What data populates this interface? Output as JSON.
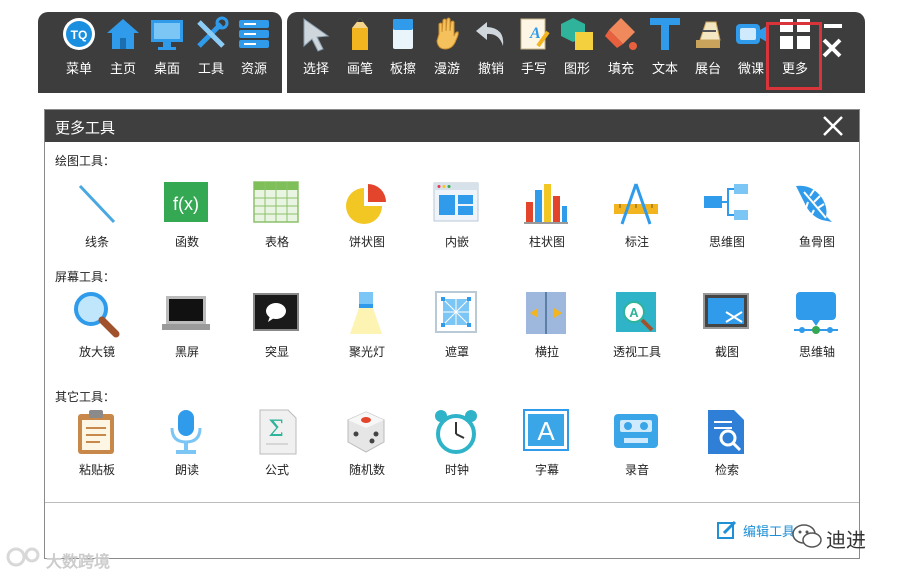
{
  "toolbar": {
    "left_items": [
      {
        "label": "菜单",
        "icon": "app-logo-icon"
      },
      {
        "label": "主页",
        "icon": "home-icon"
      },
      {
        "label": "桌面",
        "icon": "monitor-icon"
      },
      {
        "label": "工具",
        "icon": "tools-icon"
      },
      {
        "label": "资源",
        "icon": "database-icon"
      }
    ],
    "right_items": [
      {
        "label": "选择",
        "icon": "cursor-icon"
      },
      {
        "label": "画笔",
        "icon": "pencil-icon"
      },
      {
        "label": "板擦",
        "icon": "eraser-icon"
      },
      {
        "label": "漫游",
        "icon": "hand-icon"
      },
      {
        "label": "撤销",
        "icon": "undo-icon"
      },
      {
        "label": "手写",
        "icon": "handwriting-icon"
      },
      {
        "label": "图形",
        "icon": "shapes-icon"
      },
      {
        "label": "填充",
        "icon": "fill-bucket-icon"
      },
      {
        "label": "文本",
        "icon": "text-icon"
      },
      {
        "label": "展台",
        "icon": "document-camera-icon"
      },
      {
        "label": "微课",
        "icon": "camera-icon"
      },
      {
        "label": "更多",
        "icon": "grid-icon"
      }
    ]
  },
  "dialog": {
    "title": "更多工具",
    "sections": [
      {
        "title": "绘图工具：",
        "tools": [
          {
            "label": "线条",
            "icon": "line-icon"
          },
          {
            "label": "函数",
            "icon": "function-icon"
          },
          {
            "label": "表格",
            "icon": "table-icon"
          },
          {
            "label": "饼状图",
            "icon": "pie-chart-icon"
          },
          {
            "label": "内嵌",
            "icon": "embed-icon"
          },
          {
            "label": "柱状图",
            "icon": "bar-chart-icon"
          },
          {
            "label": "标注",
            "icon": "annotation-icon"
          },
          {
            "label": "思维图",
            "icon": "mind-map-icon"
          },
          {
            "label": "鱼骨图",
            "icon": "fishbone-icon"
          }
        ]
      },
      {
        "title": "屏幕工具：",
        "tools": [
          {
            "label": "放大镜",
            "icon": "magnifier-icon"
          },
          {
            "label": "黑屏",
            "icon": "black-screen-icon"
          },
          {
            "label": "突显",
            "icon": "spotlight-frame-icon"
          },
          {
            "label": "聚光灯",
            "icon": "spotlight-icon"
          },
          {
            "label": "遮罩",
            "icon": "mask-icon"
          },
          {
            "label": "横拉",
            "icon": "horizontal-pull-icon"
          },
          {
            "label": "透视工具",
            "icon": "perspective-icon"
          },
          {
            "label": "截图",
            "icon": "screenshot-icon"
          },
          {
            "label": "思维轴",
            "icon": "timeline-icon"
          }
        ]
      },
      {
        "title": "其它工具：",
        "tools": [
          {
            "label": "粘贴板",
            "icon": "clipboard-icon"
          },
          {
            "label": "朗读",
            "icon": "microphone-icon"
          },
          {
            "label": "公式",
            "icon": "formula-icon"
          },
          {
            "label": "随机数",
            "icon": "dice-icon"
          },
          {
            "label": "时钟",
            "icon": "alarm-clock-icon"
          },
          {
            "label": "字幕",
            "icon": "subtitle-icon"
          },
          {
            "label": "录音",
            "icon": "recorder-icon"
          },
          {
            "label": "检索",
            "icon": "search-document-icon"
          }
        ]
      }
    ],
    "edit_label": "编辑工具"
  },
  "watermark": {
    "left_text": "大数跨境",
    "right_text": "迪进"
  },
  "colors": {
    "toolbar_bg": "#3d3d3d",
    "highlight": "#d9343a",
    "accent": "#1f8fd6"
  }
}
